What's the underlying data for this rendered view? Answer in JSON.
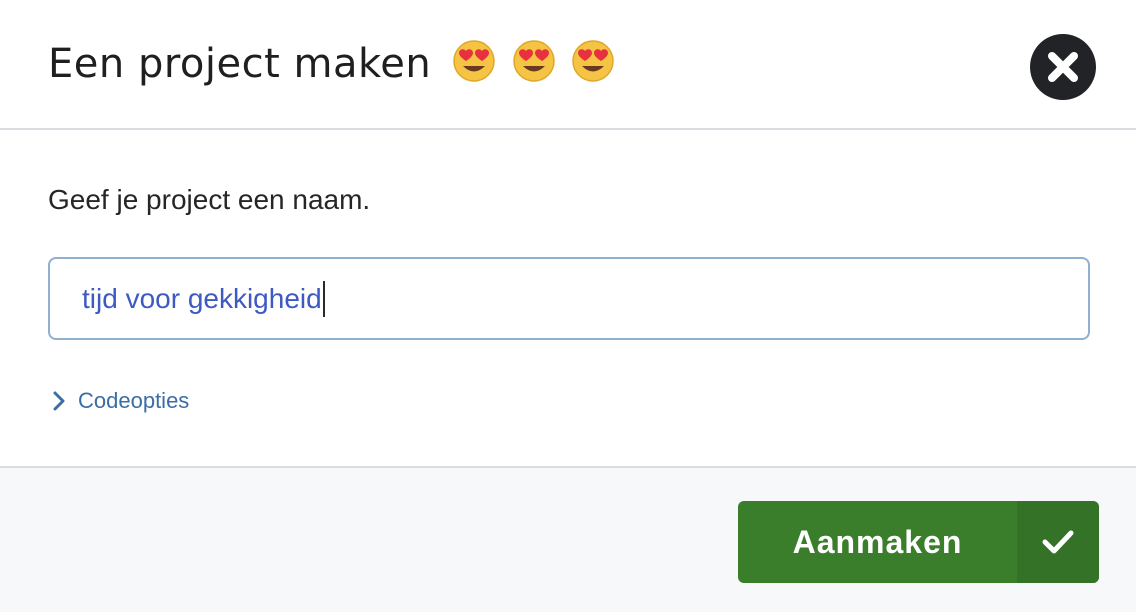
{
  "dialog": {
    "title": "Een project maken",
    "title_emojis": [
      "heart-eyes-emoji",
      "heart-eyes-emoji",
      "heart-eyes-emoji"
    ],
    "close_icon": "close-icon",
    "prompt": "Geef je project een naam.",
    "project_name": {
      "value": "tijd voor gekkigheid"
    },
    "code_options": {
      "label": "Codeopties",
      "icon": "chevron-right-icon"
    },
    "create_button": {
      "label": "Aanmaken",
      "icon": "checkmark-icon"
    }
  },
  "colors": {
    "title_text": "#1f1f1f",
    "input_border": "#8fb0cf",
    "input_text": "#3d59c4",
    "link": "#3a6ea5",
    "primary_button": "#3a7e2c",
    "primary_button_icon_bg": "#347228",
    "footer_bg": "#f7f8fa",
    "close_bg": "#222326"
  }
}
